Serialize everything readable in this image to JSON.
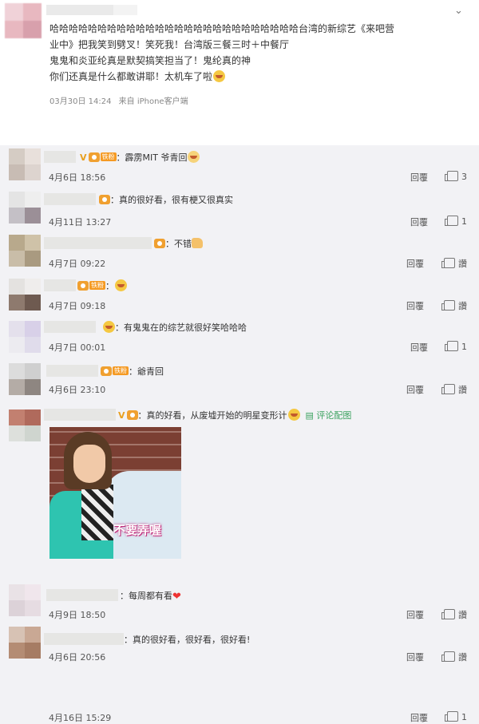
{
  "post": {
    "lines": [
      "哈哈哈哈哈哈哈哈哈哈哈哈哈哈哈哈哈哈哈哈哈哈哈哈哈哈台湾的新综艺《来吧营",
      "业中》把我笑到劈叉！笑死我！台湾版三餐三时＋中餐厅",
      "鬼鬼和炎亚纶真是默契搞笑担当了！鬼纶真的神",
      "你们还真是什么都敢讲耶！太机车了啦"
    ],
    "date": "03月30日 14:24",
    "source": "来自 iPhone客户端",
    "menu_icon": "chevron-down-icon"
  },
  "comments": [
    {
      "text": "：霹雳MIT 爷青回",
      "time": "4月6日 18:56",
      "reply": "回覆",
      "likes": "3",
      "vip": "V",
      "fan": "铁粉"
    },
    {
      "text": "：真的很好看，很有梗又很真实",
      "time": "4月11日 13:27",
      "reply": "回覆",
      "likes": "1"
    },
    {
      "text": "：不错",
      "time": "4月7日 09:22",
      "reply": "回覆",
      "likes": "讚"
    },
    {
      "text": "：",
      "time": "4月7日 09:18",
      "reply": "回覆",
      "likes": "讚",
      "fan": "铁粉"
    },
    {
      "text": "：有鬼鬼在的综艺就很好笑哈哈哈",
      "time": "4月7日 00:01",
      "reply": "回覆",
      "likes": "1"
    },
    {
      "text": "：爺青回",
      "time": "4月6日 23:10",
      "reply": "回覆",
      "likes": "讚",
      "fan": "铁粉"
    },
    {
      "text": "：真的好看，从废墟开始的明星变形计",
      "pic_label": "评论配图",
      "time": "4月16日 15:29",
      "reply": "回覆",
      "likes": "1",
      "vip": "V",
      "image_caption": "不要弄喔"
    },
    {
      "text": "：每周都有看",
      "time": "4月9日 18:50",
      "reply": "回覆",
      "likes": "讚"
    },
    {
      "text": "：真的很好看，很好看，很好看!",
      "time": "4月6日 20:56",
      "reply": "回覆",
      "likes": "讚"
    }
  ],
  "colors": {
    "accent": "#f0a030",
    "heart": "#e33333",
    "pic_link": "#3aa15e",
    "background": "#f2f2f5"
  }
}
